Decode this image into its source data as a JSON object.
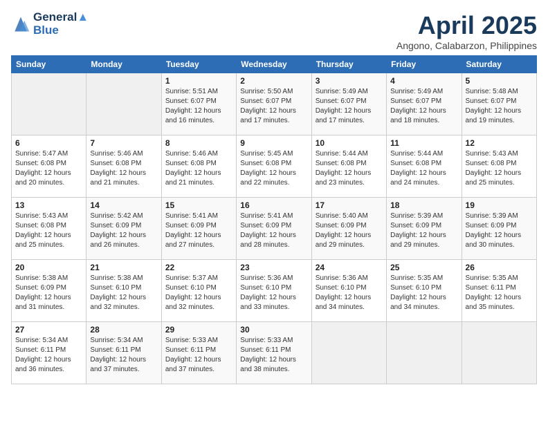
{
  "header": {
    "logo_line1": "General",
    "logo_line2": "Blue",
    "month_title": "April 2025",
    "location": "Angono, Calabarzon, Philippines"
  },
  "weekdays": [
    "Sunday",
    "Monday",
    "Tuesday",
    "Wednesday",
    "Thursday",
    "Friday",
    "Saturday"
  ],
  "weeks": [
    [
      {
        "day": "",
        "sunrise": "",
        "sunset": "",
        "daylight": ""
      },
      {
        "day": "",
        "sunrise": "",
        "sunset": "",
        "daylight": ""
      },
      {
        "day": "1",
        "sunrise": "Sunrise: 5:51 AM",
        "sunset": "Sunset: 6:07 PM",
        "daylight": "Daylight: 12 hours and 16 minutes."
      },
      {
        "day": "2",
        "sunrise": "Sunrise: 5:50 AM",
        "sunset": "Sunset: 6:07 PM",
        "daylight": "Daylight: 12 hours and 17 minutes."
      },
      {
        "day": "3",
        "sunrise": "Sunrise: 5:49 AM",
        "sunset": "Sunset: 6:07 PM",
        "daylight": "Daylight: 12 hours and 17 minutes."
      },
      {
        "day": "4",
        "sunrise": "Sunrise: 5:49 AM",
        "sunset": "Sunset: 6:07 PM",
        "daylight": "Daylight: 12 hours and 18 minutes."
      },
      {
        "day": "5",
        "sunrise": "Sunrise: 5:48 AM",
        "sunset": "Sunset: 6:07 PM",
        "daylight": "Daylight: 12 hours and 19 minutes."
      }
    ],
    [
      {
        "day": "6",
        "sunrise": "Sunrise: 5:47 AM",
        "sunset": "Sunset: 6:08 PM",
        "daylight": "Daylight: 12 hours and 20 minutes."
      },
      {
        "day": "7",
        "sunrise": "Sunrise: 5:46 AM",
        "sunset": "Sunset: 6:08 PM",
        "daylight": "Daylight: 12 hours and 21 minutes."
      },
      {
        "day": "8",
        "sunrise": "Sunrise: 5:46 AM",
        "sunset": "Sunset: 6:08 PM",
        "daylight": "Daylight: 12 hours and 21 minutes."
      },
      {
        "day": "9",
        "sunrise": "Sunrise: 5:45 AM",
        "sunset": "Sunset: 6:08 PM",
        "daylight": "Daylight: 12 hours and 22 minutes."
      },
      {
        "day": "10",
        "sunrise": "Sunrise: 5:44 AM",
        "sunset": "Sunset: 6:08 PM",
        "daylight": "Daylight: 12 hours and 23 minutes."
      },
      {
        "day": "11",
        "sunrise": "Sunrise: 5:44 AM",
        "sunset": "Sunset: 6:08 PM",
        "daylight": "Daylight: 12 hours and 24 minutes."
      },
      {
        "day": "12",
        "sunrise": "Sunrise: 5:43 AM",
        "sunset": "Sunset: 6:08 PM",
        "daylight": "Daylight: 12 hours and 25 minutes."
      }
    ],
    [
      {
        "day": "13",
        "sunrise": "Sunrise: 5:43 AM",
        "sunset": "Sunset: 6:08 PM",
        "daylight": "Daylight: 12 hours and 25 minutes."
      },
      {
        "day": "14",
        "sunrise": "Sunrise: 5:42 AM",
        "sunset": "Sunset: 6:09 PM",
        "daylight": "Daylight: 12 hours and 26 minutes."
      },
      {
        "day": "15",
        "sunrise": "Sunrise: 5:41 AM",
        "sunset": "Sunset: 6:09 PM",
        "daylight": "Daylight: 12 hours and 27 minutes."
      },
      {
        "day": "16",
        "sunrise": "Sunrise: 5:41 AM",
        "sunset": "Sunset: 6:09 PM",
        "daylight": "Daylight: 12 hours and 28 minutes."
      },
      {
        "day": "17",
        "sunrise": "Sunrise: 5:40 AM",
        "sunset": "Sunset: 6:09 PM",
        "daylight": "Daylight: 12 hours and 29 minutes."
      },
      {
        "day": "18",
        "sunrise": "Sunrise: 5:39 AM",
        "sunset": "Sunset: 6:09 PM",
        "daylight": "Daylight: 12 hours and 29 minutes."
      },
      {
        "day": "19",
        "sunrise": "Sunrise: 5:39 AM",
        "sunset": "Sunset: 6:09 PM",
        "daylight": "Daylight: 12 hours and 30 minutes."
      }
    ],
    [
      {
        "day": "20",
        "sunrise": "Sunrise: 5:38 AM",
        "sunset": "Sunset: 6:09 PM",
        "daylight": "Daylight: 12 hours and 31 minutes."
      },
      {
        "day": "21",
        "sunrise": "Sunrise: 5:38 AM",
        "sunset": "Sunset: 6:10 PM",
        "daylight": "Daylight: 12 hours and 32 minutes."
      },
      {
        "day": "22",
        "sunrise": "Sunrise: 5:37 AM",
        "sunset": "Sunset: 6:10 PM",
        "daylight": "Daylight: 12 hours and 32 minutes."
      },
      {
        "day": "23",
        "sunrise": "Sunrise: 5:36 AM",
        "sunset": "Sunset: 6:10 PM",
        "daylight": "Daylight: 12 hours and 33 minutes."
      },
      {
        "day": "24",
        "sunrise": "Sunrise: 5:36 AM",
        "sunset": "Sunset: 6:10 PM",
        "daylight": "Daylight: 12 hours and 34 minutes."
      },
      {
        "day": "25",
        "sunrise": "Sunrise: 5:35 AM",
        "sunset": "Sunset: 6:10 PM",
        "daylight": "Daylight: 12 hours and 34 minutes."
      },
      {
        "day": "26",
        "sunrise": "Sunrise: 5:35 AM",
        "sunset": "Sunset: 6:11 PM",
        "daylight": "Daylight: 12 hours and 35 minutes."
      }
    ],
    [
      {
        "day": "27",
        "sunrise": "Sunrise: 5:34 AM",
        "sunset": "Sunset: 6:11 PM",
        "daylight": "Daylight: 12 hours and 36 minutes."
      },
      {
        "day": "28",
        "sunrise": "Sunrise: 5:34 AM",
        "sunset": "Sunset: 6:11 PM",
        "daylight": "Daylight: 12 hours and 37 minutes."
      },
      {
        "day": "29",
        "sunrise": "Sunrise: 5:33 AM",
        "sunset": "Sunset: 6:11 PM",
        "daylight": "Daylight: 12 hours and 37 minutes."
      },
      {
        "day": "30",
        "sunrise": "Sunrise: 5:33 AM",
        "sunset": "Sunset: 6:11 PM",
        "daylight": "Daylight: 12 hours and 38 minutes."
      },
      {
        "day": "",
        "sunrise": "",
        "sunset": "",
        "daylight": ""
      },
      {
        "day": "",
        "sunrise": "",
        "sunset": "",
        "daylight": ""
      },
      {
        "day": "",
        "sunrise": "",
        "sunset": "",
        "daylight": ""
      }
    ]
  ]
}
